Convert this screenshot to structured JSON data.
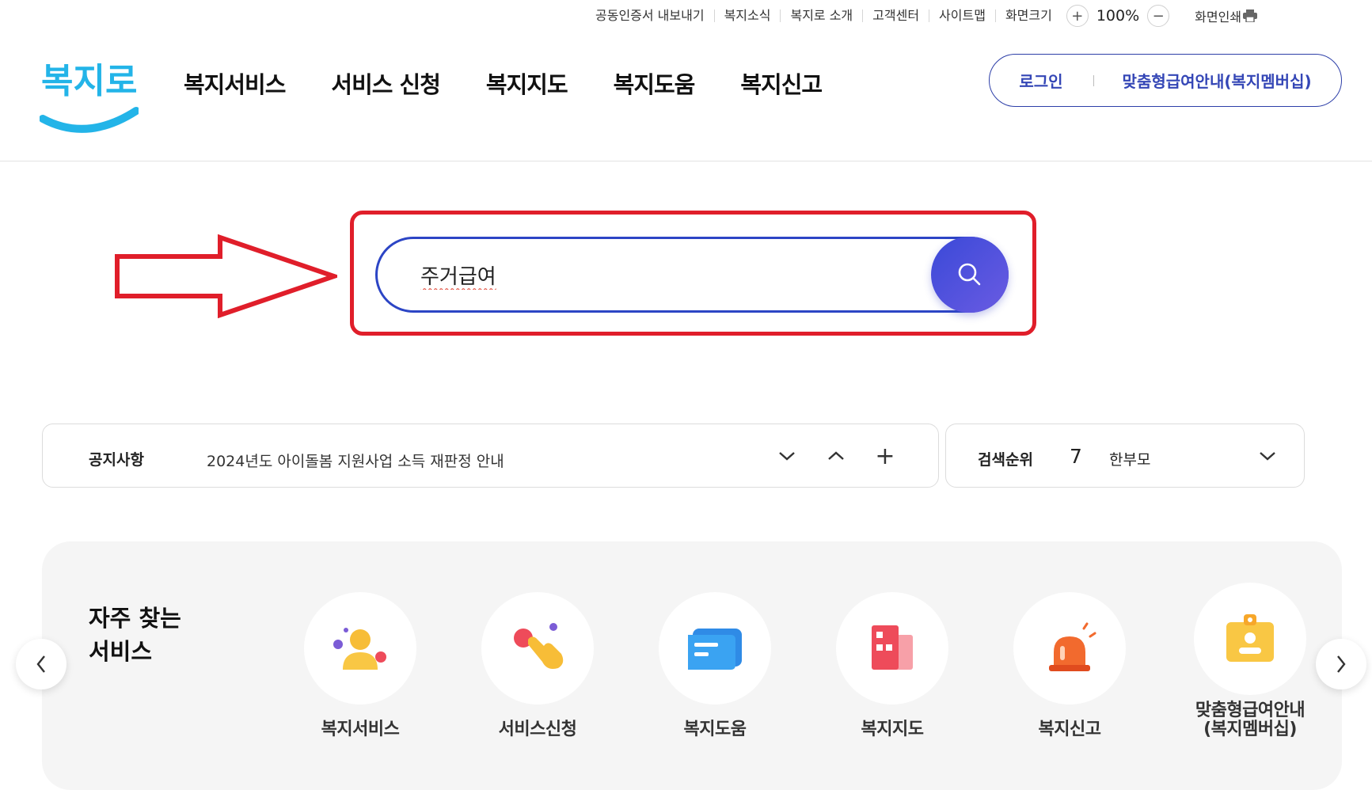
{
  "utility_bar": {
    "links": [
      "공동인증서 내보내기",
      "복지소식",
      "복지로 소개",
      "고객센터",
      "사이트맵",
      "화면크기"
    ],
    "zoom_in": "+",
    "zoom_level": "100%",
    "zoom_out": "−",
    "print_label": "화면인쇄"
  },
  "header": {
    "logo_text": "복지로",
    "nav": [
      "복지서비스",
      "서비스 신청",
      "복지지도",
      "복지도움",
      "복지신고"
    ],
    "login_label": "로그인",
    "membership_label": "맞춤형급여안내(복지멤버십)"
  },
  "search": {
    "value": "주거급여",
    "button_icon": "search-icon"
  },
  "annotation": {
    "arrow_color": "#e01e2a",
    "frame_color": "#e01e2a"
  },
  "notice": {
    "label": "공지사항",
    "text": "2024년도 아이돌봄 지원사업 소득 재판정 안내",
    "next": "⌄",
    "prev": "⌃",
    "more": "+"
  },
  "ranking": {
    "label": "검색순위",
    "rank": "7",
    "term": "한부모"
  },
  "frequent": {
    "title": "자주 찾는\n서비스",
    "items": [
      {
        "label": "복지서비스",
        "icon": "people-icon"
      },
      {
        "label": "서비스신청",
        "icon": "hand-click-icon"
      },
      {
        "label": "복지도움",
        "icon": "chat-card-icon"
      },
      {
        "label": "복지지도",
        "icon": "building-icon"
      },
      {
        "label": "복지신고",
        "icon": "siren-icon"
      },
      {
        "label": "맞춤형급여안내\n(복지멤버십)",
        "icon": "id-badge-icon"
      }
    ]
  },
  "colors": {
    "brand_blue": "#2c45c5",
    "search_gradient_start": "#3a49d8",
    "search_gradient_end": "#6a5be2",
    "logo_cyan": "#23b4e8",
    "panel_bg": "#f5f5f5"
  }
}
